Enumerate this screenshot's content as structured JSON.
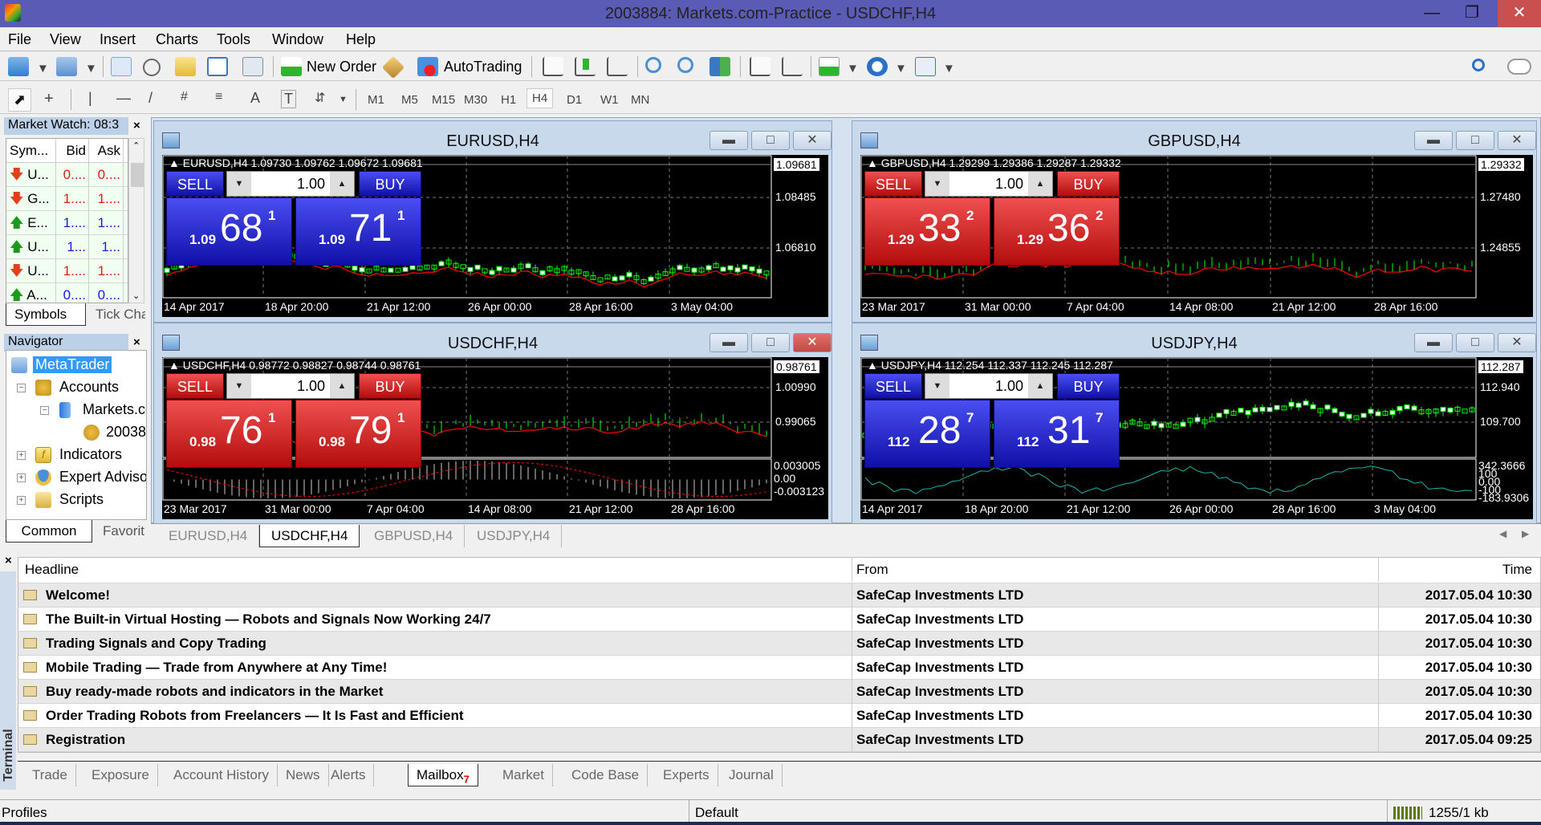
{
  "window": {
    "title": "2003884: Markets.com-Practice - USDCHF,H4"
  },
  "menu": [
    "File",
    "View",
    "Insert",
    "Charts",
    "Tools",
    "Window",
    "Help"
  ],
  "toolbar": {
    "new_order_label": "New Order",
    "autotrading_label": "AutoTrading",
    "icons": [
      "new-chart-icon",
      "profiles-icon",
      "market-watch-icon",
      "data-window-icon",
      "navigator-icon",
      "terminal-icon",
      "strategy-tester-icon",
      "new-order-icon",
      "metaeditor-icon",
      "autotrading-icon",
      "bar-chart-icon",
      "candlesticks-icon",
      "line-chart-icon",
      "zoom-in-icon",
      "zoom-out-icon",
      "tile-windows-icon",
      "chart-shift-icon",
      "autoscroll-icon",
      "indicators-icon",
      "periods-icon",
      "templates-icon",
      "search-icon",
      "chat-icon"
    ]
  },
  "drawing_toolbar": {
    "tools": [
      "cursor-icon",
      "crosshair-icon",
      "vertical-line-icon",
      "horizontal-line-icon",
      "trendline-icon",
      "fibonacci-icon",
      "fibo-fan-icon",
      "text-icon",
      "text-label-icon",
      "arrows-icon"
    ],
    "timeframes": [
      "M1",
      "M5",
      "M15",
      "M30",
      "H1",
      "H4",
      "D1",
      "W1",
      "MN"
    ],
    "active_timeframe": "H4"
  },
  "market_watch": {
    "title": "Market Watch: 08:3",
    "columns": [
      "Sym...",
      "Bid",
      "Ask"
    ],
    "rows": [
      {
        "symbol": "U...",
        "bid": "0....",
        "ask": "0....",
        "dir": "down"
      },
      {
        "symbol": "G...",
        "bid": "1....",
        "ask": "1....",
        "dir": "down"
      },
      {
        "symbol": "E...",
        "bid": "1....",
        "ask": "1....",
        "dir": "up"
      },
      {
        "symbol": "U...",
        "bid": "1...",
        "ask": "1...",
        "dir": "up"
      },
      {
        "symbol": "U...",
        "bid": "1....",
        "ask": "1....",
        "dir": "down"
      },
      {
        "symbol": "A...",
        "bid": "0....",
        "ask": "0....",
        "dir": "up"
      }
    ],
    "tabs": [
      "Symbols",
      "Tick Cha"
    ]
  },
  "navigator": {
    "title": "Navigator",
    "root": "MetaTrader",
    "accounts": "Accounts",
    "server": "Markets.cc",
    "account": "20038",
    "indicators": "Indicators",
    "experts": "Expert Adviso",
    "scripts": "Scripts",
    "tabs": [
      "Common",
      "Favorit"
    ]
  },
  "charts": [
    {
      "title": "EURUSD,H4",
      "ohlc": "EURUSD,H4  1.09730 1.09762 1.09672 1.09681",
      "theme": "blue",
      "lot": "1.00",
      "sell_label": "SELL",
      "buy_label": "BUY",
      "sell": {
        "prefix": "1.09",
        "big": "68",
        "sup": "1"
      },
      "buy": {
        "prefix": "1.09",
        "big": "71",
        "sup": "1"
      },
      "price_labels": [
        "1.08485",
        "1.06810"
      ],
      "current": "1.09681",
      "time_labels": [
        "14 Apr 2017",
        "18 Apr 20:00",
        "21 Apr 12:00",
        "26 Apr 00:00",
        "28 Apr 16:00",
        "3 May 04:00"
      ]
    },
    {
      "title": "GBPUSD,H4",
      "ohlc": "GBPUSD,H4  1.29299 1.29386 1.29287 1.29332",
      "theme": "red",
      "lot": "1.00",
      "sell_label": "SELL",
      "buy_label": "BUY",
      "sell": {
        "prefix": "1.29",
        "big": "33",
        "sup": "2"
      },
      "buy": {
        "prefix": "1.29",
        "big": "36",
        "sup": "2"
      },
      "price_labels": [
        "1.27480",
        "1.24855"
      ],
      "current": "1.29332",
      "time_labels": [
        "23 Mar 2017",
        "31 Mar 00:00",
        "7 Apr 04:00",
        "14 Apr 08:00",
        "21 Apr 12:00",
        "28 Apr 16:00"
      ]
    },
    {
      "title": "USDCHF,H4",
      "ohlc": "USDCHF,H4  0.98772 0.98827 0.98744 0.98761",
      "theme": "red",
      "lot": "1.00",
      "sell_label": "SELL",
      "buy_label": "BUY",
      "sell": {
        "prefix": "0.98",
        "big": "76",
        "sup": "1"
      },
      "buy": {
        "prefix": "0.98",
        "big": "79",
        "sup": "1"
      },
      "price_labels": [
        "1.00990",
        "0.99065"
      ],
      "current": "0.98761",
      "indicator": "MACD(12,26,9)",
      "indicator_labels": [
        "0.003005",
        "0.00",
        "-0.003123"
      ],
      "time_labels": [
        "23 Mar 2017",
        "31 Mar 00:00",
        "7 Apr 04:00",
        "14 Apr 08:00",
        "21 Apr 12:00",
        "28 Apr 16:00"
      ]
    },
    {
      "title": "USDJPY,H4",
      "ohlc": "USDJPY,H4  112.254 112.337 112.245 112.287",
      "theme": "blue",
      "lot": "1.00",
      "sell_label": "SELL",
      "buy_label": "BUY",
      "sell": {
        "prefix": "112",
        "big": "28",
        "sup": "7"
      },
      "buy": {
        "prefix": "112",
        "big": "31",
        "sup": "7"
      },
      "price_labels": [
        "112.940",
        "109.700"
      ],
      "current": "112.287",
      "indicator": "CCI(14)",
      "indicator_labels": [
        "342.3666",
        "100",
        "0.00",
        "-100",
        "-183.9306"
      ],
      "time_labels": [
        "14 Apr 2017",
        "18 Apr 20:00",
        "21 Apr 12:00",
        "26 Apr 00:00",
        "28 Apr 16:00",
        "3 May 04:00"
      ]
    }
  ],
  "chart_tabs": [
    "EURUSD,H4",
    "USDCHF,H4",
    "GBPUSD,H4",
    "USDJPY,H4"
  ],
  "active_chart_tab": "USDCHF,H4",
  "terminal": {
    "side_label": "Terminal",
    "columns": [
      "Headline",
      "From",
      "Time"
    ],
    "rows": [
      {
        "headline": "Welcome!",
        "from": "SafeCap Investments LTD",
        "time": "2017.05.04 10:30"
      },
      {
        "headline": "The Built-in Virtual Hosting — Robots and Signals Now Working 24/7",
        "from": "SafeCap Investments LTD",
        "time": "2017.05.04 10:30"
      },
      {
        "headline": "Trading Signals and Copy Trading",
        "from": "SafeCap Investments LTD",
        "time": "2017.05.04 10:30"
      },
      {
        "headline": "Mobile Trading — Trade from Anywhere at Any Time!",
        "from": "SafeCap Investments LTD",
        "time": "2017.05.04 10:30"
      },
      {
        "headline": "Buy ready-made robots and indicators in the Market",
        "from": "SafeCap Investments LTD",
        "time": "2017.05.04 10:30"
      },
      {
        "headline": "Order Trading Robots from Freelancers — It Is Fast and Efficient",
        "from": "SafeCap Investments LTD",
        "time": "2017.05.04 10:30"
      },
      {
        "headline": "Registration",
        "from": "SafeCap Investments LTD",
        "time": "2017.05.04 09:25"
      }
    ],
    "tabs": [
      "Trade",
      "Exposure",
      "Account History",
      "News",
      "Alerts",
      "Mailbox",
      "Market",
      "Code Base",
      "Experts",
      "Journal"
    ],
    "active_tab": "Mailbox",
    "mailbox_badge": "7"
  },
  "status": {
    "left": "Profiles",
    "middle": "Default",
    "traffic": "1255/1 kb"
  },
  "colors": {
    "title_bar": "#5a5bb5",
    "sell_blue": "#2a2ed8",
    "sell_red": "#d42020",
    "candle_green": "#00ff00",
    "ma_red": "#ff0000",
    "cci_teal": "#20b2aa"
  }
}
